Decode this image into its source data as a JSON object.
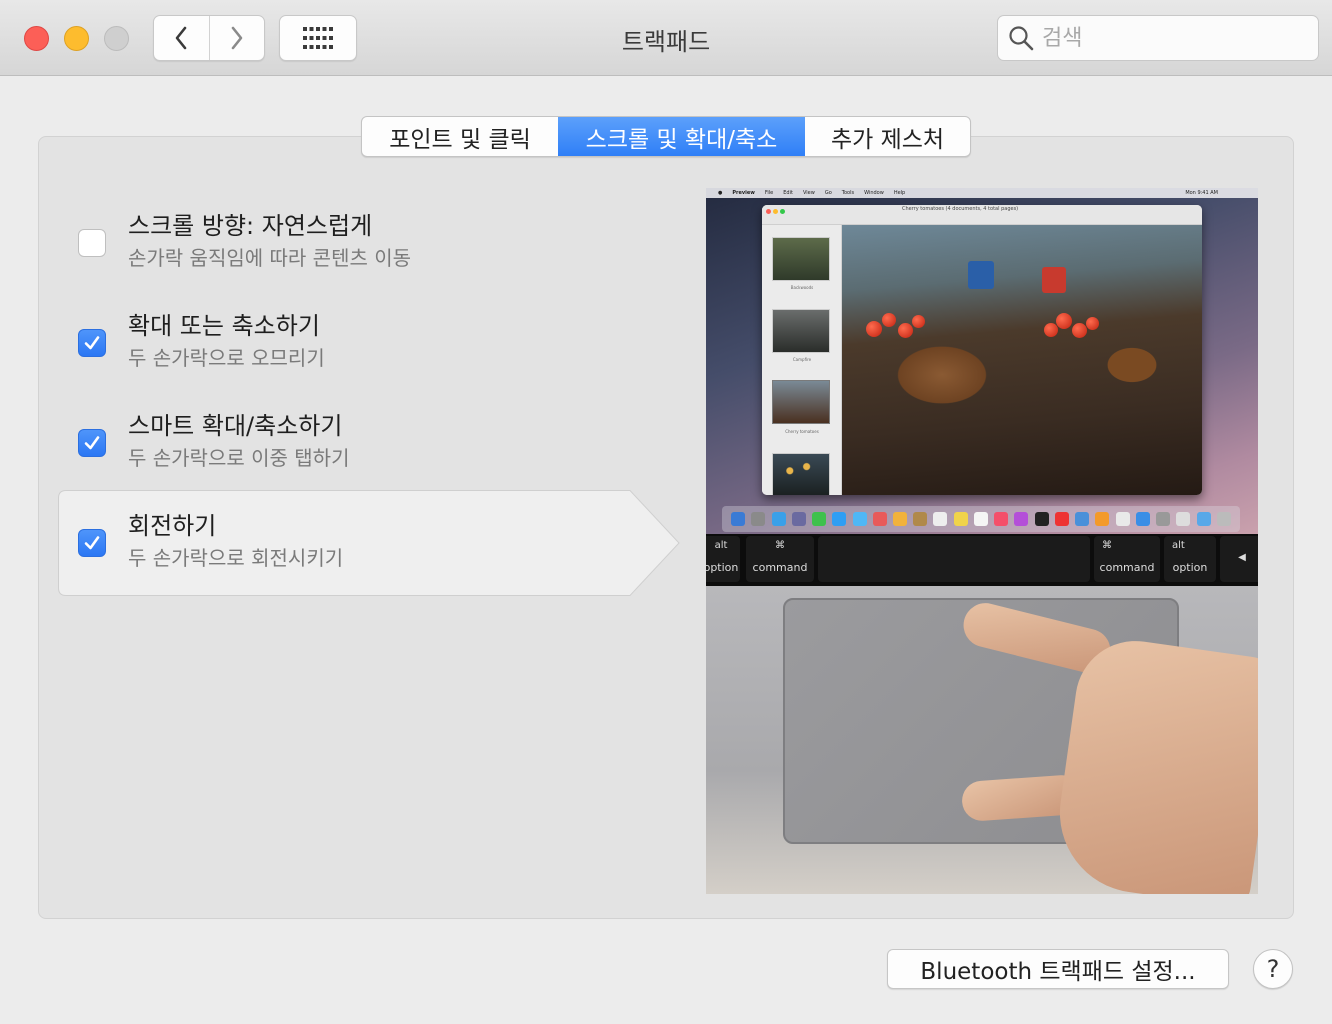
{
  "window": {
    "title": "트랙패드",
    "search_placeholder": "검색"
  },
  "tabs": [
    {
      "label": "포인트 및 클릭",
      "active": false
    },
    {
      "label": "스크롤 및 확대/축소",
      "active": true
    },
    {
      "label": "추가 제스처",
      "active": false
    }
  ],
  "options": [
    {
      "title": "스크롤 방향: 자연스럽게",
      "subtitle": "손가락 움직임에 따라 콘텐츠 이동",
      "checked": false,
      "selected": false
    },
    {
      "title": "확대 또는 축소하기",
      "subtitle": "두 손가락으로 오므리기",
      "checked": true,
      "selected": false
    },
    {
      "title": "스마트 확대/축소하기",
      "subtitle": "두 손가락으로 이중 탭하기",
      "checked": true,
      "selected": false
    },
    {
      "title": "회전하기",
      "subtitle": "두 손가락으로 회전시키기",
      "checked": true,
      "selected": true
    }
  ],
  "preview": {
    "menubar": [
      "Preview",
      "File",
      "Edit",
      "View",
      "Go",
      "Tools",
      "Window",
      "Help"
    ],
    "menubar_right": "Mon 9:41 AM",
    "window_caption": "Cherry tomatoes (4 documents, 4 total pages)",
    "thumb_labels": [
      "Backwoods",
      "Campfire",
      "Cherry tomatoes"
    ],
    "keys": {
      "alt_left": "alt",
      "option_left": "option",
      "command_left_symbol": "⌘",
      "command_left": "command",
      "command_right_symbol": "⌘",
      "command_right": "command",
      "alt_right": "alt",
      "option_right": "option",
      "arrow": "◀"
    }
  },
  "buttons": {
    "bluetooth": "Bluetooth 트랙패드 설정...",
    "help": "?"
  },
  "colors": {
    "accent": "#2f7ff7",
    "close": "#fc5f57",
    "minimize": "#fdbc2e",
    "zoom_disabled": "#cfcfcf"
  }
}
